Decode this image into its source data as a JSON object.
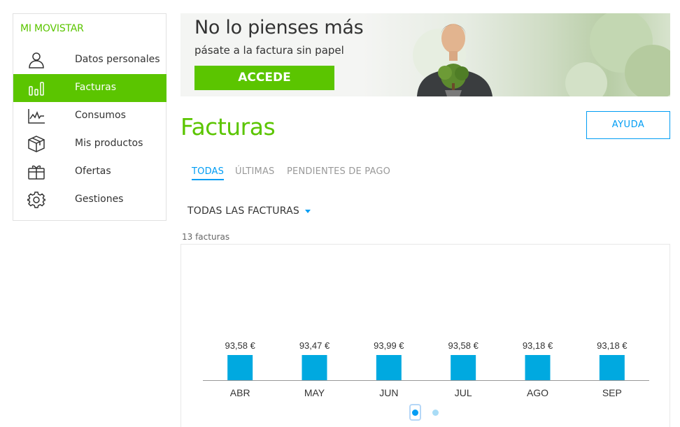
{
  "sidebar": {
    "title": "MI MOVISTAR",
    "items": [
      {
        "label": "Datos personales",
        "icon": "user-icon",
        "active": false
      },
      {
        "label": "Facturas",
        "icon": "bar-chart-icon",
        "active": true
      },
      {
        "label": "Consumos",
        "icon": "activity-icon",
        "active": false
      },
      {
        "label": "Mis productos",
        "icon": "cube-icon",
        "active": false
      },
      {
        "label": "Ofertas",
        "icon": "gift-icon",
        "active": false
      },
      {
        "label": "Gestiones",
        "icon": "gear-icon",
        "active": false
      }
    ]
  },
  "banner": {
    "headline": "No lo pienses más",
    "subline": "pásate a la factura sin papel",
    "cta": "ACCEDE"
  },
  "main": {
    "title": "Facturas",
    "help_label": "AYUDA",
    "tabs": [
      {
        "label": "TODAS",
        "active": true
      },
      {
        "label": "ÚLTIMAS",
        "active": false
      },
      {
        "label": "PENDIENTES DE PAGO",
        "active": false
      }
    ],
    "filter_label": "TODAS LAS FACTURAS",
    "count_text": "13 facturas"
  },
  "pagination": {
    "pages": 2,
    "current": 1
  },
  "colors": {
    "brand_green": "#5bc500",
    "accent_blue": "#019df4",
    "bar": "#00a9e0"
  },
  "chart_data": {
    "type": "bar",
    "categories": [
      "ABR",
      "MAY",
      "JUN",
      "JUL",
      "AGO",
      "SEP"
    ],
    "values": [
      93.58,
      93.47,
      93.99,
      93.58,
      93.18,
      93.18
    ],
    "value_labels": [
      "93,58 €",
      "93,47 €",
      "93,99 €",
      "93,58 €",
      "93,18 €",
      "93,18 €"
    ]
  }
}
